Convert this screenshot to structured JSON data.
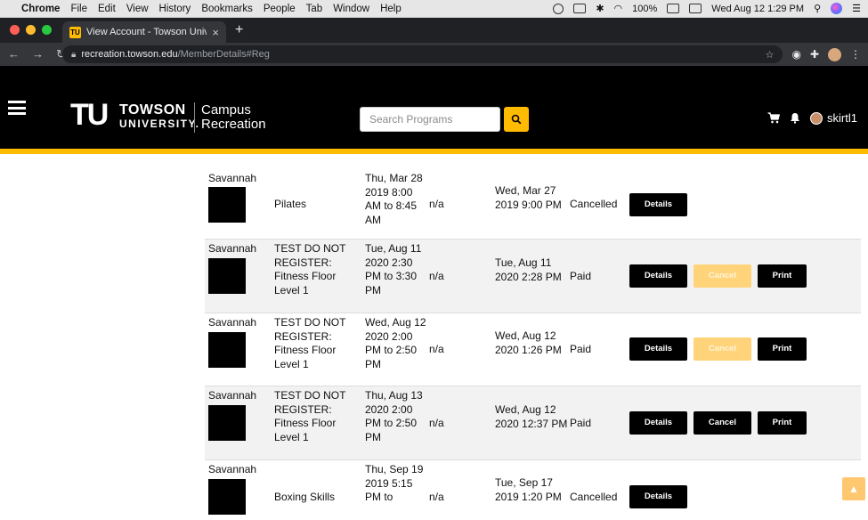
{
  "menubar": {
    "app": "Chrome",
    "items": [
      "File",
      "Edit",
      "View",
      "History",
      "Bookmarks",
      "People",
      "Tab",
      "Window",
      "Help"
    ],
    "battery": "100%",
    "clock": "Wed Aug 12  1:29 PM"
  },
  "browser": {
    "tab_title": "View Account - Towson Univer",
    "url_host": "recreation.towson.edu",
    "url_path": "/MemberDetails#Reg"
  },
  "header": {
    "logo_letters": "TU",
    "logo_line1": "TOWSON",
    "logo_line2": "UNIVERSITY.",
    "logo_sub1": "Campus",
    "logo_sub2": "Recreation",
    "search_placeholder": "Search Programs",
    "username": "skirtl1"
  },
  "rows": [
    {
      "name": "Savannah",
      "program": "Pilates",
      "date": "Thu, Mar 28 2019 8:00 AM to 8:45 AM",
      "na": "n/a",
      "registered": "Wed, Mar 27 2019 9:00 PM",
      "status": "Cancelled",
      "details_label": "Details"
    },
    {
      "name": "Savannah",
      "program": "TEST DO NOT REGISTER: Fitness Floor Level 1",
      "date": "Tue, Aug 11 2020 2:30 PM to 3:30 PM",
      "na": "n/a",
      "registered": "Tue, Aug 11 2020 2:28 PM",
      "status": "Paid",
      "details_label": "Details",
      "cancel_label": "Cancel",
      "print_label": "Print"
    },
    {
      "name": "Savannah",
      "program": "TEST DO NOT REGISTER: Fitness Floor Level 1",
      "date": "Wed, Aug 12 2020 2:00 PM to 2:50 PM",
      "na": "n/a",
      "registered": "Wed, Aug 12 2020 1:26 PM",
      "status": "Paid",
      "details_label": "Details",
      "cancel_label": "Cancel",
      "print_label": "Print"
    },
    {
      "name": "Savannah",
      "program": "TEST DO NOT REGISTER: Fitness Floor Level 1",
      "date": "Thu, Aug 13 2020 2:00 PM to 2:50 PM",
      "na": "n/a",
      "registered": "Wed, Aug 12 2020 12:37 PM",
      "status": "Paid",
      "details_label": "Details",
      "cancel_label": "Cancel",
      "print_label": "Print"
    },
    {
      "name": "Savannah",
      "program": "Boxing Skills",
      "date": "Thu, Sep 19 2019 5:15 PM to",
      "na": "n/a",
      "registered": "Tue, Sep 17 2019 1:20 PM",
      "status": "Cancelled",
      "details_label": "Details"
    }
  ],
  "colors": {
    "brand_gold": "#ffbb00",
    "header_black": "#000000",
    "disabled_gold": "#ffd37a"
  }
}
